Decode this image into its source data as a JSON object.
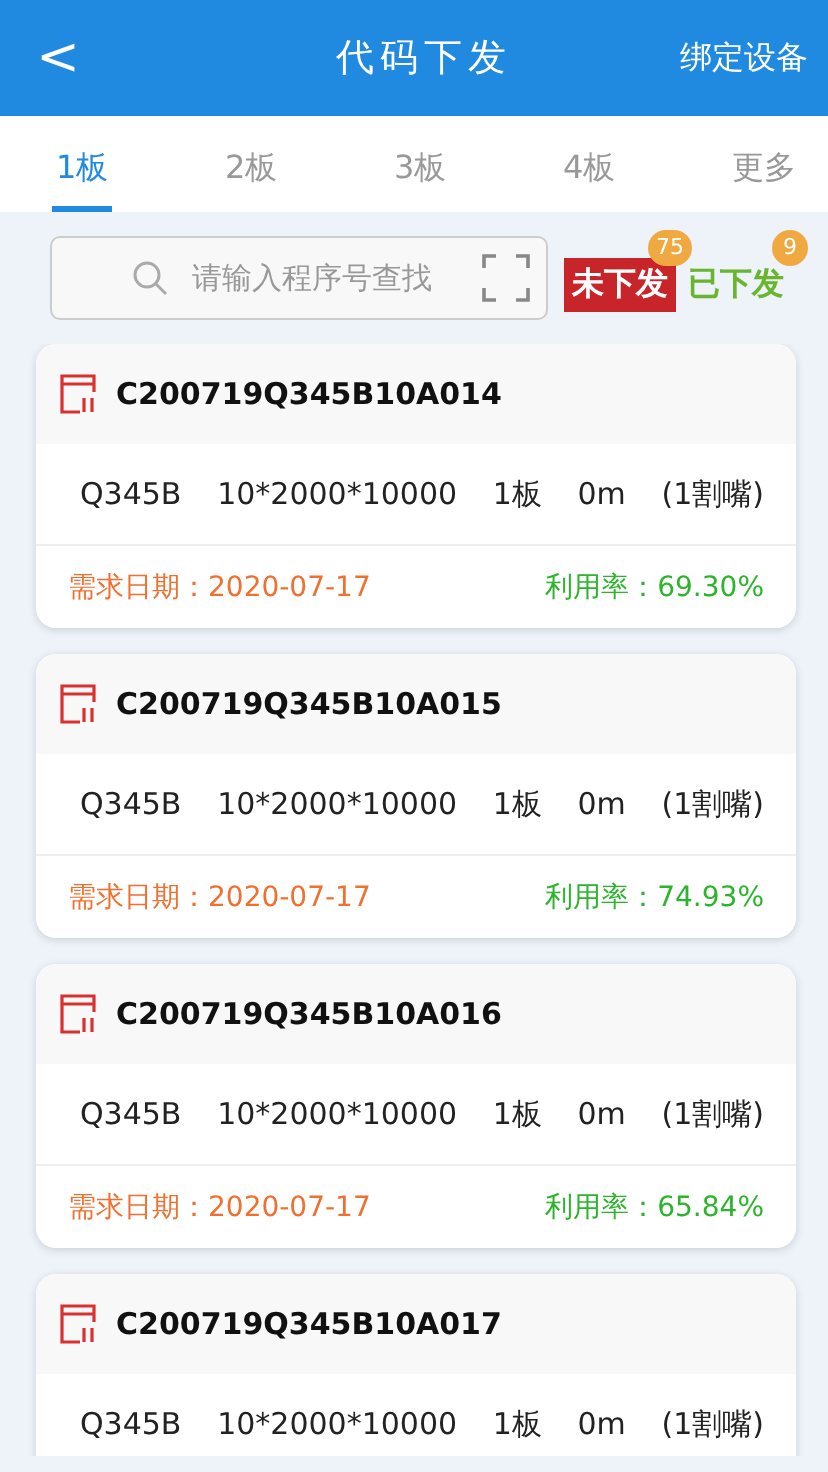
{
  "header": {
    "back": "<",
    "title": "代码下发",
    "action": "绑定设备"
  },
  "tabs": [
    {
      "label": "1板",
      "selected": true
    },
    {
      "label": "2板",
      "selected": false
    },
    {
      "label": "3板",
      "selected": false
    },
    {
      "label": "4板",
      "selected": false
    },
    {
      "label": "更多",
      "selected": false
    }
  ],
  "search": {
    "placeholder": "请输入程序号查找"
  },
  "filters": [
    {
      "label": "未下发",
      "count": "75",
      "selected": true
    },
    {
      "label": "已下发",
      "count": "9",
      "selected": false
    }
  ],
  "orders": [
    {
      "code": "C200719Q345B10A014",
      "specs": [
        "Q345B",
        "10*2000*10000",
        "1板",
        "0m",
        "(1割嘴)"
      ],
      "date": "需求日期：2020-07-17",
      "rate": "利用率：69.30%"
    },
    {
      "code": "C200719Q345B10A015",
      "specs": [
        "Q345B",
        "10*2000*10000",
        "1板",
        "0m",
        "(1割嘴)"
      ],
      "date": "需求日期：2020-07-17",
      "rate": "利用率：74.93%"
    },
    {
      "code": "C200719Q345B10A016",
      "specs": [
        "Q345B",
        "10*2000*10000",
        "1板",
        "0m",
        "(1割嘴)"
      ],
      "date": "需求日期：2020-07-17",
      "rate": "利用率：65.84%"
    },
    {
      "code": "C200719Q345B10A017",
      "specs": [
        "Q345B",
        "10*2000*10000",
        "1板",
        "0m",
        "(1割嘴)"
      ]
    }
  ]
}
